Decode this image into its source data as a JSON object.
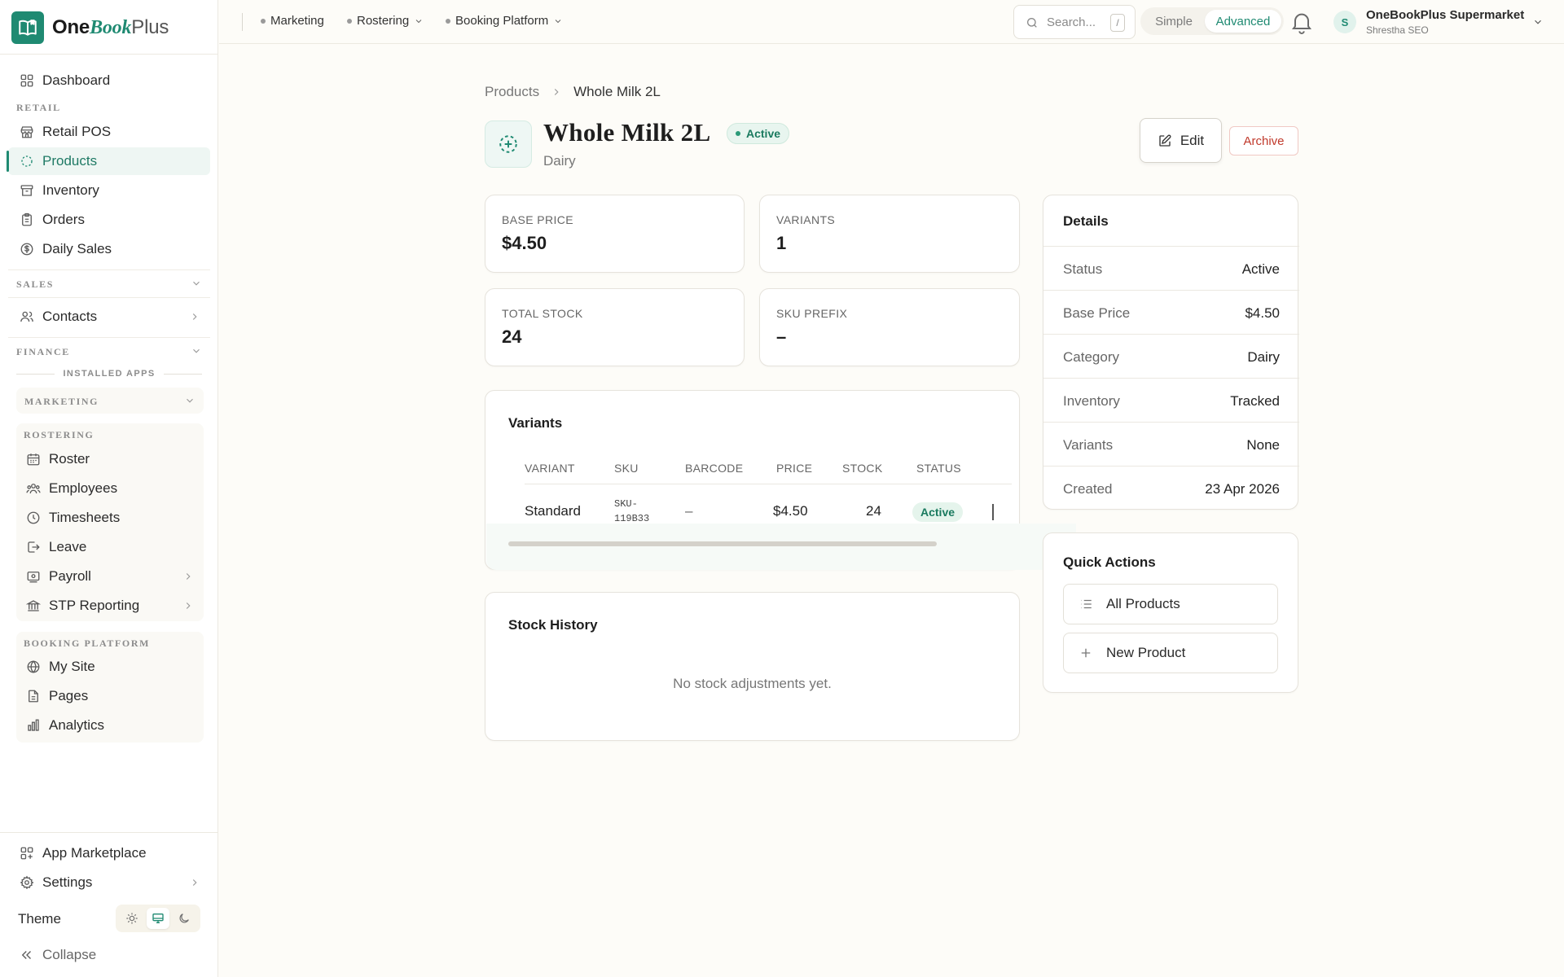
{
  "brand": {
    "part1": "One",
    "part2": "Book",
    "part3": "Plus"
  },
  "sidebar": {
    "dashboard": "Dashboard",
    "retail_label": "RETAIL",
    "retail_items": [
      "Retail POS",
      "Products",
      "Inventory",
      "Orders",
      "Daily Sales"
    ],
    "sales_label": "SALES",
    "contacts": "Contacts",
    "finance_label": "FINANCE",
    "installed_apps": "INSTALLED APPS",
    "marketing_label": "MARKETING",
    "rostering_label": "ROSTERING",
    "rostering_items": [
      "Roster",
      "Employees",
      "Timesheets",
      "Leave",
      "Payroll",
      "STP Reporting"
    ],
    "booking_label": "BOOKING PLATFORM",
    "booking_items": [
      "My Site",
      "Pages",
      "Analytics"
    ],
    "app_marketplace": "App Marketplace",
    "settings": "Settings",
    "theme": "Theme",
    "collapse": "Collapse"
  },
  "topbar": {
    "nav": [
      "Marketing",
      "Rostering",
      "Booking Platform"
    ],
    "search_placeholder": "Search...",
    "search_shortcut": "/",
    "mode_simple": "Simple",
    "mode_advanced": "Advanced",
    "avatar_initial": "S",
    "org_name": "OneBookPlus Supermarket",
    "org_user": "Shrestha SEO"
  },
  "breadcrumb": {
    "parent": "Products",
    "current": "Whole Milk 2L"
  },
  "product": {
    "name": "Whole Milk 2L",
    "status": "Active",
    "category": "Dairy",
    "edit_label": "Edit",
    "archive_label": "Archive"
  },
  "stats": [
    {
      "label": "BASE PRICE",
      "value": "$4.50"
    },
    {
      "label": "VARIANTS",
      "value": "1"
    },
    {
      "label": "TOTAL STOCK",
      "value": "24"
    },
    {
      "label": "SKU PREFIX",
      "value": "–"
    }
  ],
  "variants": {
    "title": "Variants",
    "columns": [
      "VARIANT",
      "SKU",
      "BARCODE",
      "PRICE",
      "STOCK",
      "STATUS"
    ],
    "rows": [
      {
        "variant": "Standard",
        "sku_line1": "SKU-",
        "sku_line2": "119B33",
        "barcode": "–",
        "price": "$4.50",
        "stock": "24",
        "status": "Active"
      }
    ]
  },
  "stock_history": {
    "title": "Stock History",
    "empty": "No stock adjustments yet."
  },
  "details": {
    "title": "Details",
    "rows": [
      {
        "key": "Status",
        "value": "Active"
      },
      {
        "key": "Base Price",
        "value": "$4.50"
      },
      {
        "key": "Category",
        "value": "Dairy"
      },
      {
        "key": "Inventory",
        "value": "Tracked"
      },
      {
        "key": "Variants",
        "value": "None"
      },
      {
        "key": "Created",
        "value": "23 Apr 2026"
      }
    ]
  },
  "quick_actions": {
    "title": "Quick Actions",
    "all_products": "All Products",
    "new_product": "New Product"
  },
  "colors": {
    "accent": "#1f8a72",
    "danger": "#c0392b",
    "background": "#fdfcf8"
  }
}
